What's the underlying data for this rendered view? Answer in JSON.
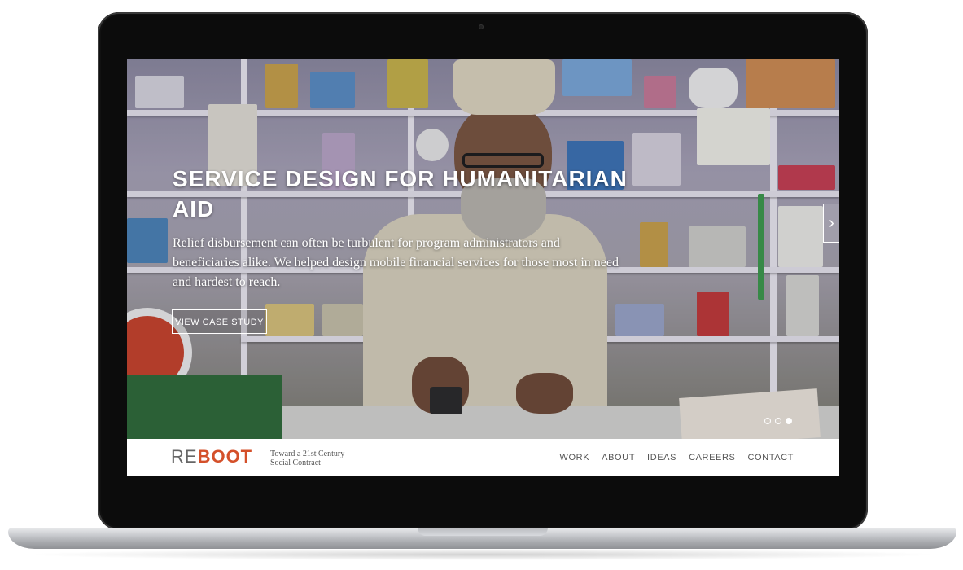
{
  "hero": {
    "title": "SERVICE DESIGN FOR HUMANITARIAN AID",
    "description": "Relief disbursement can often be turbulent for program administrators and beneficiaries alike. We helped design mobile financial services for those most in need and hardest to reach.",
    "cta_label": "VIEW CASE STUDY",
    "next_arrow": "›",
    "slides_total": 3,
    "active_slide": 3
  },
  "brand": {
    "logo_prefix": "RE",
    "logo_suffix": "BOOT",
    "tagline_line1": "Toward a 21st Century",
    "tagline_line2": "Social Contract",
    "accent_color": "#d4502a"
  },
  "nav": {
    "items": [
      {
        "label": "WORK"
      },
      {
        "label": "ABOUT"
      },
      {
        "label": "IDEAS"
      },
      {
        "label": "CAREERS"
      },
      {
        "label": "CONTACT"
      }
    ]
  }
}
